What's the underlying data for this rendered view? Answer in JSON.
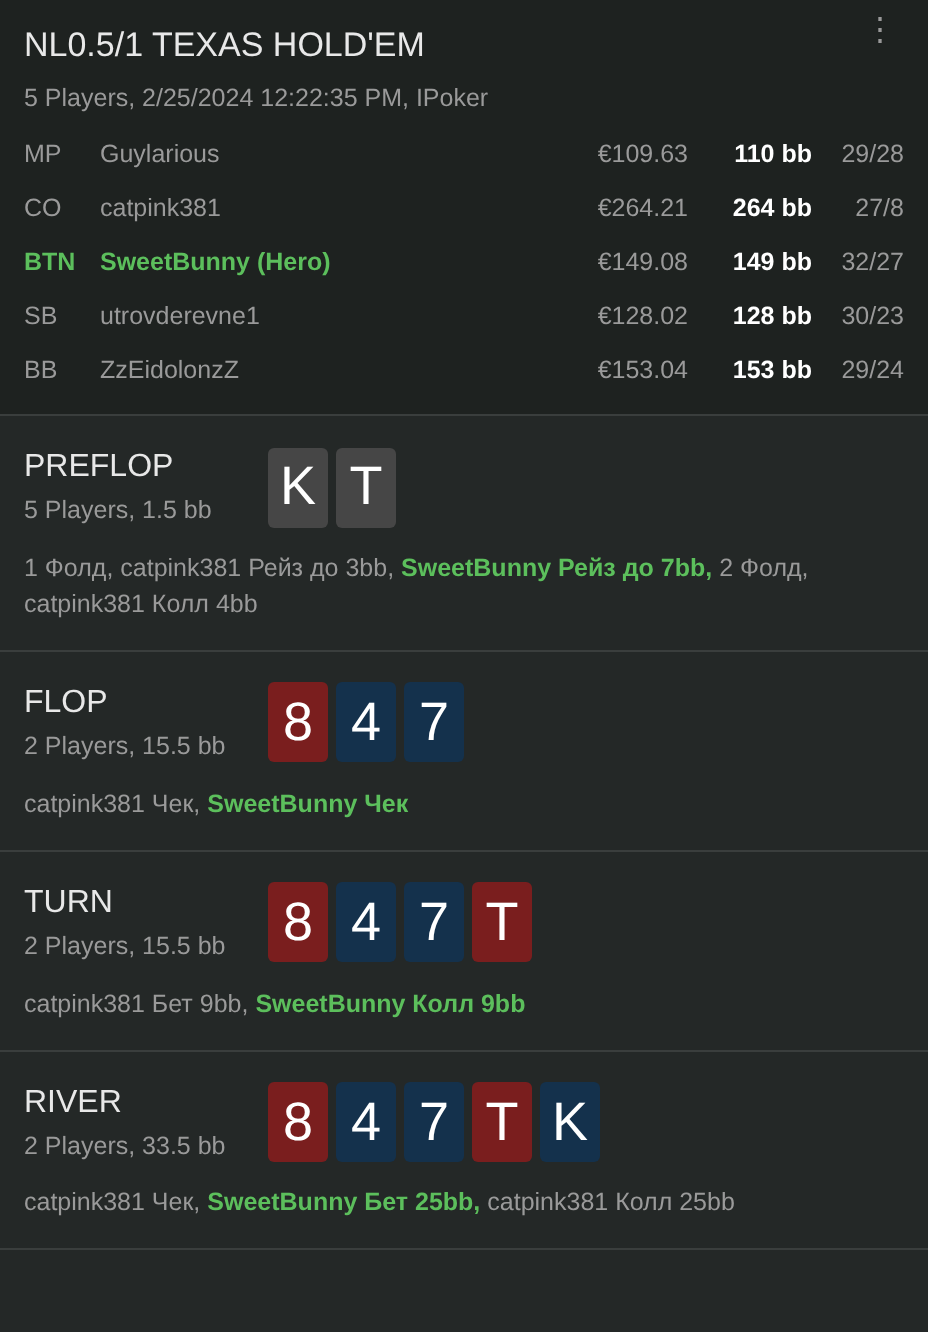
{
  "header": {
    "title": "NL0.5/1 TEXAS HOLD'EM",
    "menu_icon": "⋮",
    "subtitle": "5 Players, 2/25/2024 12:22:35 PM, IPoker"
  },
  "players": [
    {
      "position": "MP",
      "name": "Guylarious",
      "hero": false,
      "stack": "€109.63",
      "bb": "110 bb",
      "stats": "29/28"
    },
    {
      "position": "CO",
      "name": "catpink381",
      "hero": false,
      "stack": "€264.21",
      "bb": "264 bb",
      "stats": "27/8"
    },
    {
      "position": "BTN",
      "name": "SweetBunny (Hero)",
      "hero": true,
      "stack": "€149.08",
      "bb": "149 bb",
      "stats": "32/27"
    },
    {
      "position": "SB",
      "name": "utrovderevne1",
      "hero": false,
      "stack": "€128.02",
      "bb": "128 bb",
      "stats": "30/23"
    },
    {
      "position": "BB",
      "name": "ZzEidolonzZ",
      "hero": false,
      "stack": "€153.04",
      "bb": "153 bb",
      "stats": "29/24"
    }
  ],
  "streets": [
    {
      "name": "PREFLOP",
      "info": "5 Players, 1.5 bb",
      "cards": [
        {
          "rank": "K",
          "color": "#464646"
        },
        {
          "rank": "T",
          "color": "#464646"
        }
      ],
      "actions": [
        {
          "text": "1 Фолд, catpink381 Рейз до 3bb,",
          "hero": false
        },
        {
          "text": "SweetBunny Рейз до 7bb,",
          "hero": true
        },
        {
          "text": "2 Фолд, catpink381 Колл 4bb",
          "hero": false
        }
      ]
    },
    {
      "name": "FLOP",
      "info": "2 Players, 15.5 bb",
      "cards": [
        {
          "rank": "8",
          "color": "#7a1e1e"
        },
        {
          "rank": "4",
          "color": "#14314c"
        },
        {
          "rank": "7",
          "color": "#14314c"
        }
      ],
      "actions": [
        {
          "text": "catpink381 Чек,",
          "hero": false
        },
        {
          "text": "SweetBunny Чек",
          "hero": true
        }
      ]
    },
    {
      "name": "TURN",
      "info": "2 Players, 15.5 bb",
      "cards": [
        {
          "rank": "8",
          "color": "#7a1e1e"
        },
        {
          "rank": "4",
          "color": "#14314c"
        },
        {
          "rank": "7",
          "color": "#14314c"
        },
        {
          "rank": "T",
          "color": "#7a1e1e"
        }
      ],
      "actions": [
        {
          "text": "catpink381 Бет 9bb,",
          "hero": false
        },
        {
          "text": "SweetBunny Колл 9bb",
          "hero": true
        }
      ]
    },
    {
      "name": "RIVER",
      "info": "2 Players, 33.5 bb",
      "cards": [
        {
          "rank": "8",
          "color": "#7a1e1e"
        },
        {
          "rank": "4",
          "color": "#14314c"
        },
        {
          "rank": "7",
          "color": "#14314c"
        },
        {
          "rank": "T",
          "color": "#7a1e1e"
        },
        {
          "rank": "K",
          "color": "#14314c"
        }
      ],
      "actions": [
        {
          "text": "catpink381 Чек,",
          "hero": false
        },
        {
          "text": "SweetBunny Бет 25bb,",
          "hero": true
        },
        {
          "text": "catpink381 Колл 25bb",
          "hero": false
        }
      ]
    }
  ]
}
